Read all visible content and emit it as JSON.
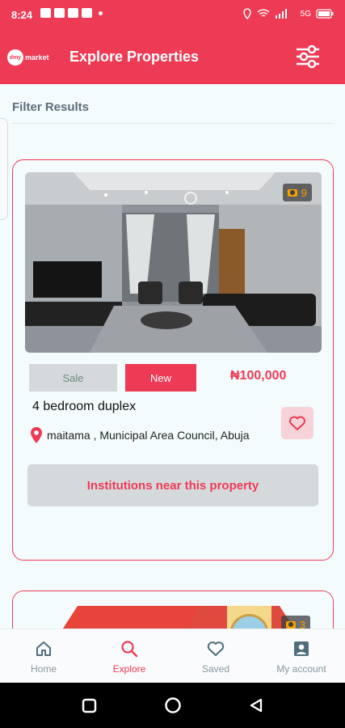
{
  "status_bar": {
    "time": "8:24",
    "network": "5G"
  },
  "app_bar": {
    "logo_text": "market",
    "logo_mark": "dmy",
    "title": "Explore Properties"
  },
  "filter": {
    "heading": "Filter Results"
  },
  "listing": {
    "photo_count": "9",
    "sale_tag": "Sale",
    "new_tag": "New",
    "price": "₦100,000",
    "title": "4 bedroom duplex",
    "location": "maitama , Municipal Area Council, Abuja",
    "institutions_button": "Institutions near this property"
  },
  "listing2": {
    "photo_count": "3"
  },
  "bottom_nav": {
    "items": [
      {
        "label": "Home",
        "icon": "home-icon"
      },
      {
        "label": "Explore",
        "icon": "search-icon"
      },
      {
        "label": "Saved",
        "icon": "heart-icon"
      },
      {
        "label": "My account",
        "icon": "account-icon"
      }
    ]
  },
  "colors": {
    "accent": "#ee3b55",
    "tag_grey": "#d6d9dc",
    "photo_badge": "#f2a200"
  }
}
